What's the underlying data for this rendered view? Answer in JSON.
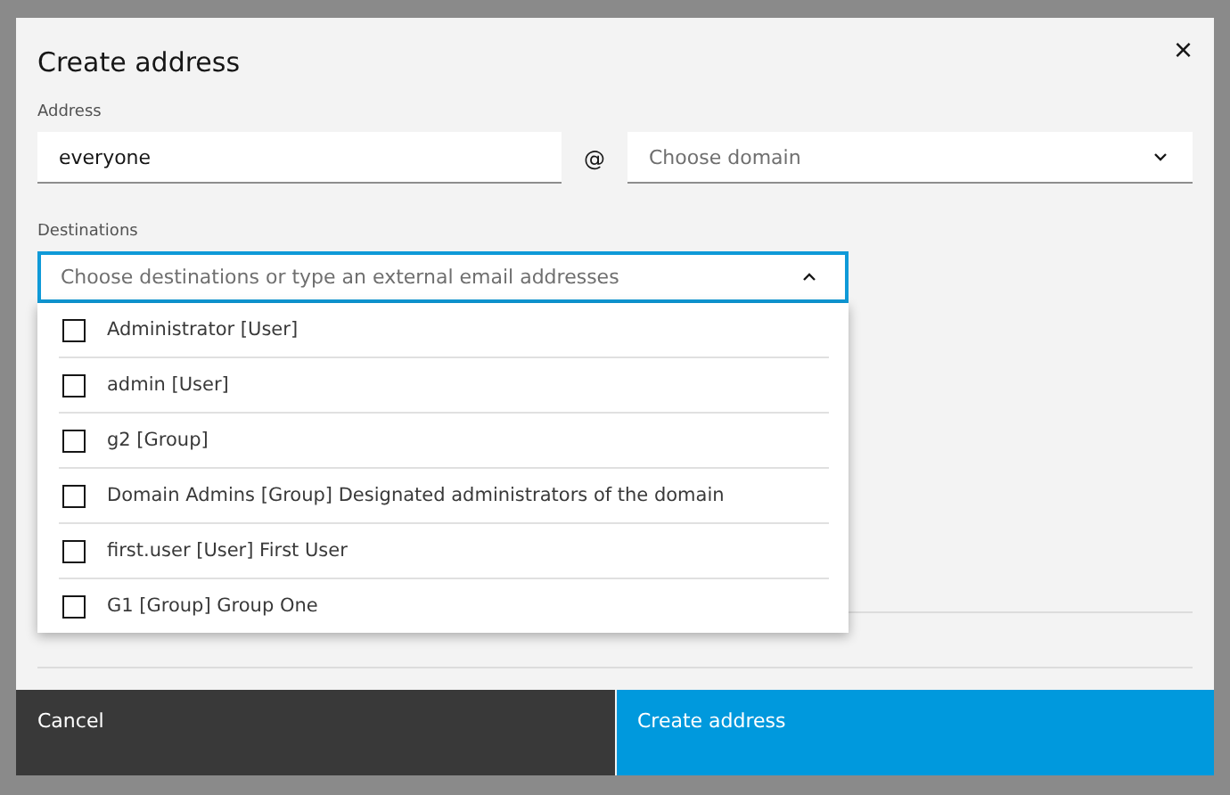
{
  "dialog": {
    "title": "Create address",
    "close": "×"
  },
  "address": {
    "label": "Address",
    "value": "everyone",
    "separator": "@",
    "domain": {
      "placeholder": "Choose domain",
      "expanded": false
    }
  },
  "destinations": {
    "label": "Destinations",
    "placeholder": "Choose destinations or type an external email addresses",
    "expanded": true,
    "options": [
      {
        "label": "Administrator [User]",
        "checked": false
      },
      {
        "label": "admin [User]",
        "checked": false
      },
      {
        "label": "g2 [Group]",
        "checked": false
      },
      {
        "label": "Domain Admins [Group] Designated administrators of the domain",
        "checked": false
      },
      {
        "label": "first.user [User] First User",
        "checked": false
      },
      {
        "label": "G1 [Group] Group One",
        "checked": false
      }
    ]
  },
  "buttons": [
    {
      "label": "Cancel",
      "kind": "secondary"
    },
    {
      "label": "Create address",
      "kind": "primary"
    }
  ]
}
